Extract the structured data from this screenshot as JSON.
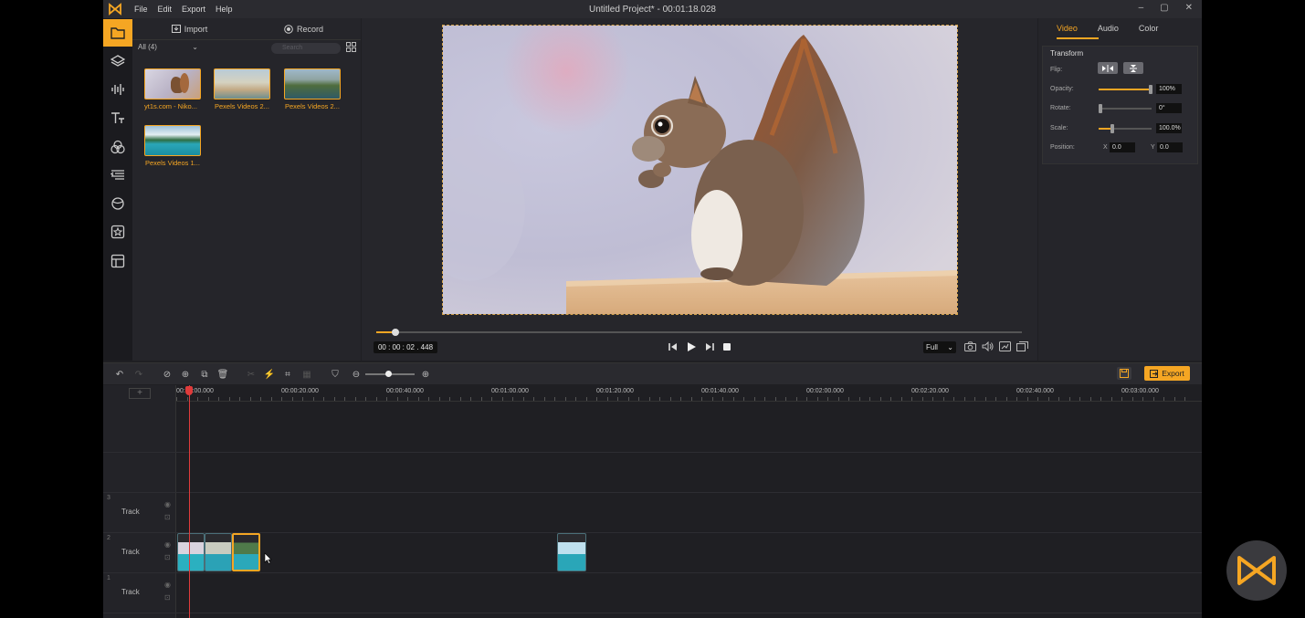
{
  "titlebar": {
    "menu": [
      "File",
      "Edit",
      "Export",
      "Help"
    ],
    "title": "Untitled Project* - 00:01:18.028",
    "window_buttons": [
      "–",
      "▢",
      "✕"
    ]
  },
  "rail": {
    "items": [
      "folder-icon",
      "layers-icon",
      "audio-wave-icon",
      "text-icon",
      "effects-icon",
      "transitions-icon",
      "filters-icon",
      "stickers-icon",
      "templates-icon"
    ]
  },
  "media": {
    "import_label": "Import",
    "record_label": "Record",
    "filter_label": "All (4)",
    "search_placeholder": "Search",
    "items": [
      {
        "label": "yt1s.com - Niko..."
      },
      {
        "label": "Pexels Videos 2..."
      },
      {
        "label": "Pexels Videos 2..."
      },
      {
        "label": "Pexels Videos 1..."
      }
    ]
  },
  "preview": {
    "timecode": "00 : 00 : 02 . 448",
    "quality": "Full",
    "progress": 0.03
  },
  "props": {
    "tabs": [
      "Video",
      "Audio",
      "Color"
    ],
    "section_title": "Transform",
    "labels": {
      "flip": "Flip:",
      "opacity": "Opacity:",
      "rotate": "Rotate:",
      "scale": "Scale:",
      "position": "Position:"
    },
    "values": {
      "opacity": "100%",
      "rotate": "0°",
      "scale": "100.0%",
      "pos_x_label": "X",
      "pos_x": "0.0",
      "pos_y_label": "Y",
      "pos_y": "0.0"
    }
  },
  "toolbar": {
    "export_label": "Export"
  },
  "timeline": {
    "add_track": "+",
    "ruler": [
      "00:00:00.000",
      "00:00:20.000",
      "00:00:40.000",
      "00:01:00.000",
      "00:01:20.000",
      "00:01:40.000",
      "00:02:00.000",
      "00:02:20.000",
      "00:02:40.000",
      "00:03:00.000"
    ],
    "tracks": [
      {
        "num": "3",
        "name": "Track"
      },
      {
        "num": "2",
        "name": "Track"
      },
      {
        "num": "1",
        "name": "Track"
      }
    ]
  },
  "colors": {
    "accent": "#f5a623",
    "playhead": "#e03b3b"
  }
}
